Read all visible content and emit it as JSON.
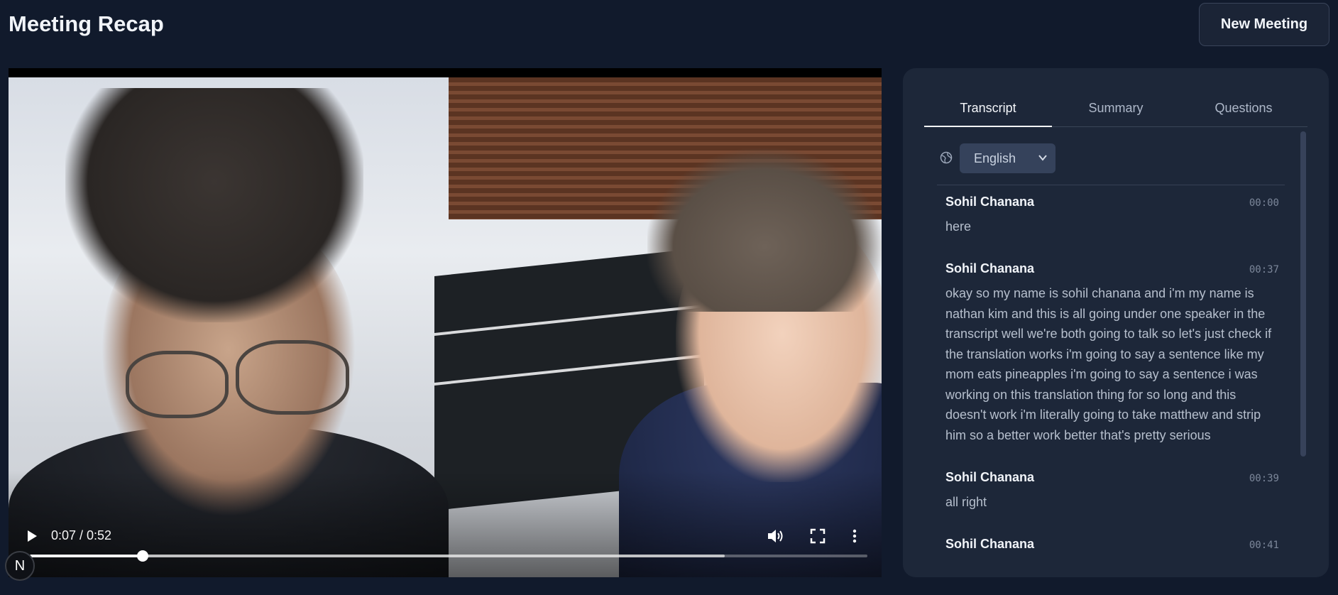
{
  "header": {
    "title": "Meeting Recap",
    "new_meeting_label": "New Meeting"
  },
  "video": {
    "current_time": "0:07",
    "duration": "0:52",
    "time_display": "0:07 / 0:52",
    "progress_fraction": 0.135,
    "buffered_fraction": 0.83,
    "badge_letter": "N"
  },
  "panel": {
    "tabs": [
      {
        "label": "Transcript",
        "active": true
      },
      {
        "label": "Summary",
        "active": false
      },
      {
        "label": "Questions",
        "active": false
      }
    ],
    "language": {
      "selected": "English",
      "icon": "globe-icon"
    },
    "transcript": [
      {
        "speaker": "Sohil Chanana",
        "time": "00:00",
        "text": "here"
      },
      {
        "speaker": "Sohil Chanana",
        "time": "00:37",
        "text": "okay so my name is sohil chanana and i'm my name is nathan kim and this is all going under one speaker in the transcript well we're both going to talk so let's just check if the translation works i'm going to say a sentence like my mom eats pineapples i'm going to say a sentence i was working on this translation thing for so long and this doesn't work i'm literally going to take matthew and strip him so a better work better that's pretty serious"
      },
      {
        "speaker": "Sohil Chanana",
        "time": "00:39",
        "text": "all right"
      },
      {
        "speaker": "Sohil Chanana",
        "time": "00:41",
        "text": ""
      }
    ]
  },
  "colors": {
    "background": "#111a2c",
    "panel": "#1d2739",
    "select": "#35425b"
  }
}
